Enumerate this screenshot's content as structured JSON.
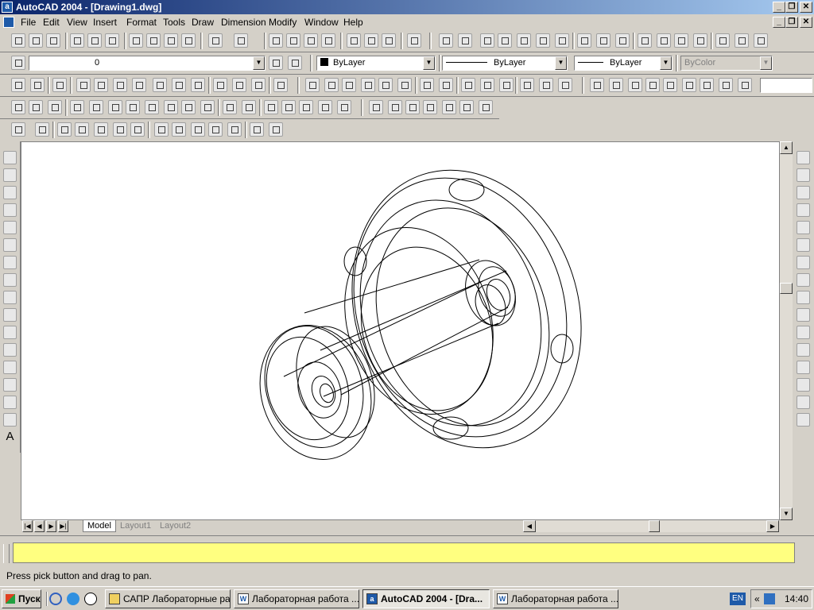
{
  "window": {
    "title": "AutoCAD 2004 - [Drawing1.dwg]",
    "app_icon": "a"
  },
  "menu": [
    "File",
    "Edit",
    "View",
    "Insert",
    "Format",
    "Tools",
    "Draw",
    "Dimension",
    "Modify",
    "Window",
    "Help"
  ],
  "properties": {
    "layer": "0",
    "color": "ByLayer",
    "linetype": "ByLayer",
    "lineweight": "ByLayer",
    "plotstyle": "ByColor"
  },
  "layout_tabs": [
    "Model",
    "Layout1",
    "Layout2"
  ],
  "command_line": "",
  "status_text": "Press pick button and drag to pan.",
  "taskbar": {
    "start": "Пуск",
    "tasks": [
      {
        "label": "САПР Лабораторные ра...",
        "icon": "folder-icon",
        "active": false
      },
      {
        "label": "Лабораторная работа ...",
        "icon": "word-icon",
        "active": false
      },
      {
        "label": "AutoCAD 2004 - [Dra...",
        "icon": "autocad-icon",
        "active": true
      },
      {
        "label": "Лабораторная работа ...",
        "icon": "word-icon",
        "active": false
      }
    ],
    "lang": "EN",
    "clock": "14:40"
  }
}
